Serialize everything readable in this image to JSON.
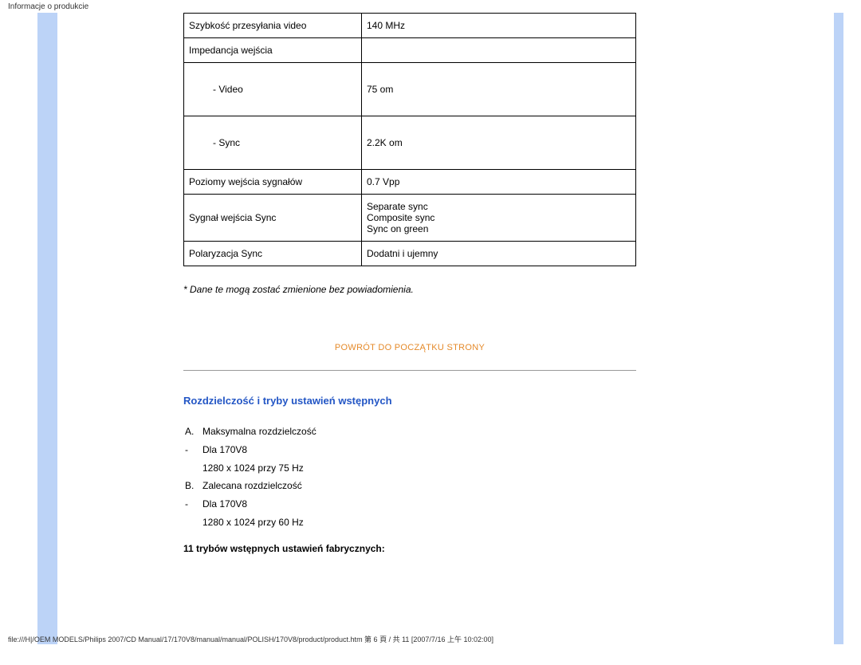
{
  "header": "Informacje o produkcie",
  "table": {
    "rows": [
      {
        "label": "Szybkość przesyłania video",
        "value": "140 MHz",
        "cls": ""
      },
      {
        "label": "Impedancja wejścia",
        "value": "",
        "cls": ""
      },
      {
        "label": "- Video",
        "value": "75 om",
        "cls": "sublabel"
      },
      {
        "label": "- Sync",
        "value": "2.2K om",
        "cls": "sublabel"
      },
      {
        "label": "Poziomy wejścia sygnałów",
        "value": "0.7 Vpp",
        "cls": ""
      },
      {
        "label": "Sygnał wejścia Sync",
        "value": "Separate sync\nComposite sync\nSync on green",
        "cls": ""
      },
      {
        "label": "Polaryzacja Sync",
        "value": "Dodatni i ujemny",
        "cls": ""
      }
    ]
  },
  "note": "* Dane te mogą zostać zmienione bez powiadomienia.",
  "back_link": "POWRÓT DO POCZĄTKU STRONY",
  "section_title": "Rozdzielczość i tryby ustawień wstępnych",
  "resolution": {
    "items": [
      {
        "bullet": "A.",
        "text": "Maksymalna rozdzielczość"
      },
      {
        "bullet": "-",
        "text": "Dla 170V8"
      },
      {
        "bullet": "",
        "text": "1280 x 1024 przy 75 Hz"
      },
      {
        "bullet": "B.",
        "text": "Zalecana rozdzielczość"
      },
      {
        "bullet": "-",
        "text": "Dla 170V8"
      },
      {
        "bullet": "",
        "text": "1280 x 1024 przy 60 Hz"
      }
    ]
  },
  "subtitle": "11 trybów wstępnych ustawień fabrycznych:",
  "footer": "file:///H|/OEM MODELS/Philips 2007/CD Manual/17/170V8/manual/manual/POLISH/170V8/product/product.htm 第 6 頁 / 共 11  [2007/7/16 上午 10:02:00]"
}
